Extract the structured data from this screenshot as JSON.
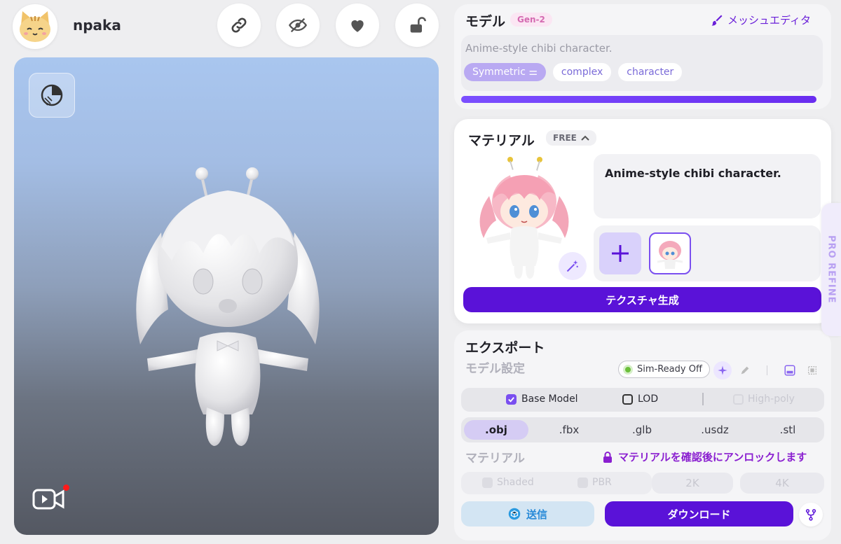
{
  "user": {
    "name": "npaka"
  },
  "model_panel": {
    "title": "モデル",
    "badge": "Gen-2",
    "mesh_editor": "メッシュエディタ",
    "prompt": "Anime-style chibi character.",
    "tags": [
      "Symmetric",
      "complex",
      "character"
    ],
    "progress": 1.0
  },
  "material_panel": {
    "title": "マテリアル",
    "badge": "FREE",
    "prompt": "Anime-style chibi character.",
    "generate_label": "テクスチャ生成"
  },
  "export_panel": {
    "title": "エクスポート",
    "model_settings": "モデル設定",
    "sim_ready": "Sim-Ready Off",
    "options": {
      "base_model": "Base Model",
      "lod": "LOD",
      "high_poly": "High-poly"
    },
    "formats": [
      ".obj",
      ".fbx",
      ".glb",
      ".usdz",
      ".stl"
    ],
    "active_format": ".obj",
    "material_label": "マテリアル",
    "unlock_text": "マテリアルを確認後にアンロックします",
    "material_opts": {
      "shaded": "Shaded",
      "pbr": "PBR"
    },
    "resolutions": [
      "2K",
      "4K"
    ],
    "send_label": "送信",
    "download_label": "ダウンロード"
  },
  "side_tab": {
    "label": "PRO REFINE"
  },
  "colors": {
    "accent": "#5a12d8",
    "progress": "#6a2df0",
    "record_dot": "#ff1a1a"
  },
  "icons": [
    "link-icon",
    "eye-off-icon",
    "heart-icon",
    "unlock-icon",
    "render-mode-icon",
    "video-record-icon",
    "brush-icon",
    "magic-wand-icon",
    "plus-icon",
    "sparkle-icon",
    "pen-icon",
    "frame-icon",
    "grid-icon",
    "lock-icon",
    "box-icon",
    "branch-icon"
  ]
}
